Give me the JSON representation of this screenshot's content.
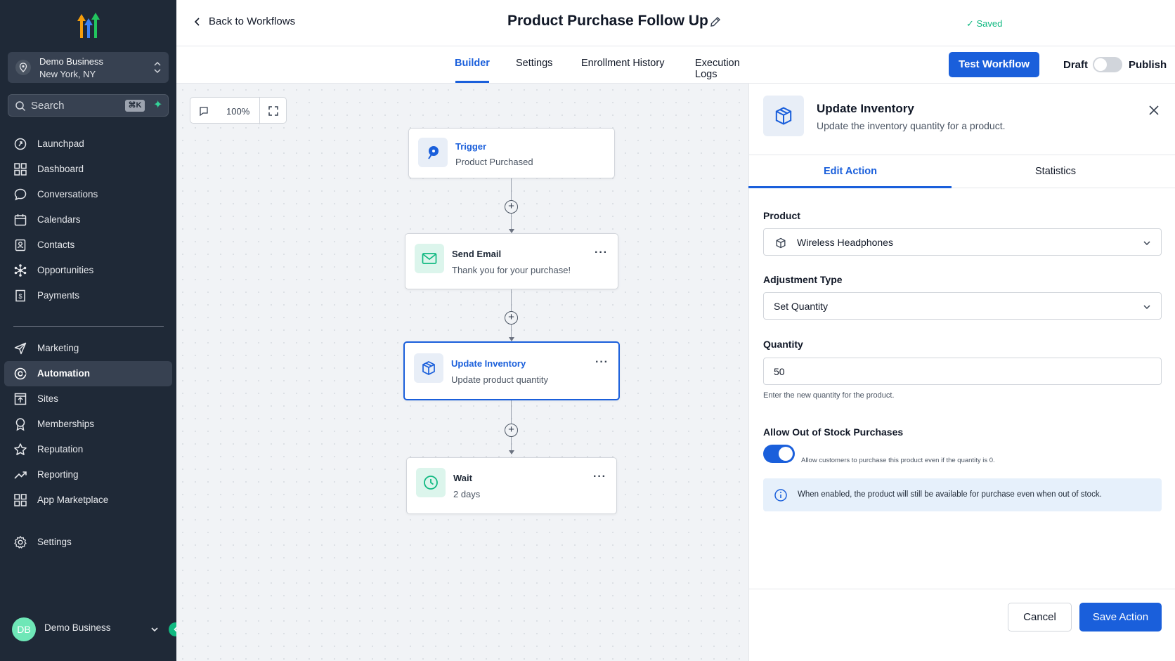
{
  "sidebar": {
    "account": {
      "name": "Demo Business",
      "location": "New York, NY"
    },
    "search": {
      "placeholder": "Search",
      "shortcut": "⌘K"
    },
    "items": [
      {
        "label": "Launchpad",
        "icon": "launchpad-icon"
      },
      {
        "label": "Dashboard",
        "icon": "dashboard-icon"
      },
      {
        "label": "Conversations",
        "icon": "chat-icon"
      },
      {
        "label": "Calendars",
        "icon": "calendar-icon"
      },
      {
        "label": "Contacts",
        "icon": "contacts-icon"
      },
      {
        "label": "Opportunities",
        "icon": "opportunities-icon"
      },
      {
        "label": "Payments",
        "icon": "payments-icon"
      },
      {
        "label": "Marketing",
        "icon": "send-icon"
      },
      {
        "label": "Automation",
        "icon": "automation-icon",
        "active": true
      },
      {
        "label": "Sites",
        "icon": "sites-icon"
      },
      {
        "label": "Memberships",
        "icon": "award-icon"
      },
      {
        "label": "Reputation",
        "icon": "star-icon"
      },
      {
        "label": "Reporting",
        "icon": "trending-icon"
      },
      {
        "label": "App Marketplace",
        "icon": "grid-icon"
      },
      {
        "label": "Settings",
        "icon": "gear-icon"
      }
    ],
    "user": {
      "initials": "DB",
      "name": "Demo Business"
    }
  },
  "header": {
    "back_label": "Back to Workflows",
    "title": "Product Purchase Follow Up",
    "saved_label": "✓  Saved"
  },
  "tabs": {
    "builder": "Builder",
    "settings": "Settings",
    "enrollment": "Enrollment History",
    "logs": "Execution Logs"
  },
  "actions": {
    "test_workflow": "Test Workflow",
    "draft": "Draft",
    "publish": "Publish",
    "publish_enabled": false
  },
  "canvas": {
    "zoom": "100%",
    "nodes": [
      {
        "title": "Trigger",
        "subtitle": "Product Purchased",
        "icon": "trigger-icon"
      },
      {
        "title": "Send Email",
        "subtitle": "Thank you for your purchase!",
        "icon": "mail-icon"
      },
      {
        "title": "Update Inventory",
        "subtitle": "Update product quantity",
        "icon": "box-icon",
        "selected": true
      },
      {
        "title": "Wait",
        "subtitle": "2 days",
        "icon": "clock-icon"
      }
    ],
    "more_label": "···",
    "plus_label": "+"
  },
  "panel": {
    "title": "Update Inventory",
    "subtitle": "Update the inventory quantity for a product.",
    "tab_edit": "Edit Action",
    "tab_stats": "Statistics",
    "product_label": "Product",
    "product_value": "Wireless Headphones",
    "adjustment_label": "Adjustment Type",
    "adjustment_value": "Set Quantity",
    "quantity_label": "Quantity",
    "quantity_value": "50",
    "quantity_help": "Enter the new quantity for the product.",
    "oos_label": "Allow Out of Stock Purchases",
    "oos_enabled": true,
    "oos_desc": "Allow customers to purchase this product even if the quantity is 0.",
    "info_text": "When enabled, the product will still be available for purchase even when out of stock.",
    "cancel": "Cancel",
    "save": "Save Action"
  },
  "colors": {
    "accent": "#1a5fdb",
    "sidebar": "#1f2937",
    "success": "#10b981"
  }
}
